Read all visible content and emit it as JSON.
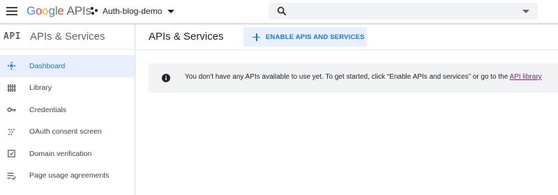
{
  "header": {
    "logo": {
      "letters": [
        "G",
        "o",
        "o",
        "g",
        "l",
        "e"
      ],
      "suffix": "APIs"
    },
    "project": {
      "name": "Auth-blog-demo"
    },
    "search": {
      "value": "",
      "placeholder": ""
    }
  },
  "sidebar": {
    "badge": "API",
    "title": "APIs & Services",
    "items": [
      {
        "label": "Dashboard",
        "icon": "dashboard-icon",
        "active": true
      },
      {
        "label": "Library",
        "icon": "library-icon",
        "active": false
      },
      {
        "label": "Credentials",
        "icon": "key-icon",
        "active": false
      },
      {
        "label": "OAuth consent screen",
        "icon": "consent-icon",
        "active": false
      },
      {
        "label": "Domain verification",
        "icon": "domain-icon",
        "active": false
      },
      {
        "label": "Page usage agreements",
        "icon": "agreements-icon",
        "active": false
      }
    ]
  },
  "main": {
    "title": "APIs & Services",
    "enable_button": "ENABLE APIS AND SERVICES",
    "notice": {
      "text": "You don't have any APIs available to use yet. To get started, click “Enable APIs and services” or go to the ",
      "link": "API library"
    }
  },
  "colors": {
    "accent": "#1a73e8",
    "active_bg": "#e8f0fe",
    "banner_bg": "#f1f3f4",
    "link_visited": "#7b1fa2"
  }
}
